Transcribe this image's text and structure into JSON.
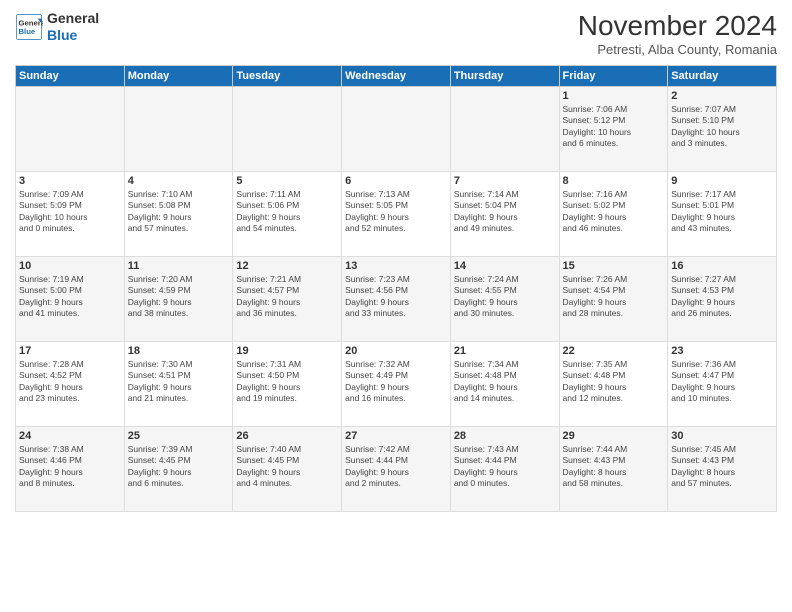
{
  "header": {
    "logo_line1": "General",
    "logo_line2": "Blue",
    "month": "November 2024",
    "location": "Petresti, Alba County, Romania"
  },
  "days_of_week": [
    "Sunday",
    "Monday",
    "Tuesday",
    "Wednesday",
    "Thursday",
    "Friday",
    "Saturday"
  ],
  "weeks": [
    [
      {
        "day": "",
        "info": ""
      },
      {
        "day": "",
        "info": ""
      },
      {
        "day": "",
        "info": ""
      },
      {
        "day": "",
        "info": ""
      },
      {
        "day": "",
        "info": ""
      },
      {
        "day": "1",
        "info": "Sunrise: 7:06 AM\nSunset: 5:12 PM\nDaylight: 10 hours\nand 6 minutes."
      },
      {
        "day": "2",
        "info": "Sunrise: 7:07 AM\nSunset: 5:10 PM\nDaylight: 10 hours\nand 3 minutes."
      }
    ],
    [
      {
        "day": "3",
        "info": "Sunrise: 7:09 AM\nSunset: 5:09 PM\nDaylight: 10 hours\nand 0 minutes."
      },
      {
        "day": "4",
        "info": "Sunrise: 7:10 AM\nSunset: 5:08 PM\nDaylight: 9 hours\nand 57 minutes."
      },
      {
        "day": "5",
        "info": "Sunrise: 7:11 AM\nSunset: 5:06 PM\nDaylight: 9 hours\nand 54 minutes."
      },
      {
        "day": "6",
        "info": "Sunrise: 7:13 AM\nSunset: 5:05 PM\nDaylight: 9 hours\nand 52 minutes."
      },
      {
        "day": "7",
        "info": "Sunrise: 7:14 AM\nSunset: 5:04 PM\nDaylight: 9 hours\nand 49 minutes."
      },
      {
        "day": "8",
        "info": "Sunrise: 7:16 AM\nSunset: 5:02 PM\nDaylight: 9 hours\nand 46 minutes."
      },
      {
        "day": "9",
        "info": "Sunrise: 7:17 AM\nSunset: 5:01 PM\nDaylight: 9 hours\nand 43 minutes."
      }
    ],
    [
      {
        "day": "10",
        "info": "Sunrise: 7:19 AM\nSunset: 5:00 PM\nDaylight: 9 hours\nand 41 minutes."
      },
      {
        "day": "11",
        "info": "Sunrise: 7:20 AM\nSunset: 4:59 PM\nDaylight: 9 hours\nand 38 minutes."
      },
      {
        "day": "12",
        "info": "Sunrise: 7:21 AM\nSunset: 4:57 PM\nDaylight: 9 hours\nand 36 minutes."
      },
      {
        "day": "13",
        "info": "Sunrise: 7:23 AM\nSunset: 4:56 PM\nDaylight: 9 hours\nand 33 minutes."
      },
      {
        "day": "14",
        "info": "Sunrise: 7:24 AM\nSunset: 4:55 PM\nDaylight: 9 hours\nand 30 minutes."
      },
      {
        "day": "15",
        "info": "Sunrise: 7:26 AM\nSunset: 4:54 PM\nDaylight: 9 hours\nand 28 minutes."
      },
      {
        "day": "16",
        "info": "Sunrise: 7:27 AM\nSunset: 4:53 PM\nDaylight: 9 hours\nand 26 minutes."
      }
    ],
    [
      {
        "day": "17",
        "info": "Sunrise: 7:28 AM\nSunset: 4:52 PM\nDaylight: 9 hours\nand 23 minutes."
      },
      {
        "day": "18",
        "info": "Sunrise: 7:30 AM\nSunset: 4:51 PM\nDaylight: 9 hours\nand 21 minutes."
      },
      {
        "day": "19",
        "info": "Sunrise: 7:31 AM\nSunset: 4:50 PM\nDaylight: 9 hours\nand 19 minutes."
      },
      {
        "day": "20",
        "info": "Sunrise: 7:32 AM\nSunset: 4:49 PM\nDaylight: 9 hours\nand 16 minutes."
      },
      {
        "day": "21",
        "info": "Sunrise: 7:34 AM\nSunset: 4:48 PM\nDaylight: 9 hours\nand 14 minutes."
      },
      {
        "day": "22",
        "info": "Sunrise: 7:35 AM\nSunset: 4:48 PM\nDaylight: 9 hours\nand 12 minutes."
      },
      {
        "day": "23",
        "info": "Sunrise: 7:36 AM\nSunset: 4:47 PM\nDaylight: 9 hours\nand 10 minutes."
      }
    ],
    [
      {
        "day": "24",
        "info": "Sunrise: 7:38 AM\nSunset: 4:46 PM\nDaylight: 9 hours\nand 8 minutes."
      },
      {
        "day": "25",
        "info": "Sunrise: 7:39 AM\nSunset: 4:45 PM\nDaylight: 9 hours\nand 6 minutes."
      },
      {
        "day": "26",
        "info": "Sunrise: 7:40 AM\nSunset: 4:45 PM\nDaylight: 9 hours\nand 4 minutes."
      },
      {
        "day": "27",
        "info": "Sunrise: 7:42 AM\nSunset: 4:44 PM\nDaylight: 9 hours\nand 2 minutes."
      },
      {
        "day": "28",
        "info": "Sunrise: 7:43 AM\nSunset: 4:44 PM\nDaylight: 9 hours\nand 0 minutes."
      },
      {
        "day": "29",
        "info": "Sunrise: 7:44 AM\nSunset: 4:43 PM\nDaylight: 8 hours\nand 58 minutes."
      },
      {
        "day": "30",
        "info": "Sunrise: 7:45 AM\nSunset: 4:43 PM\nDaylight: 8 hours\nand 57 minutes."
      }
    ]
  ]
}
